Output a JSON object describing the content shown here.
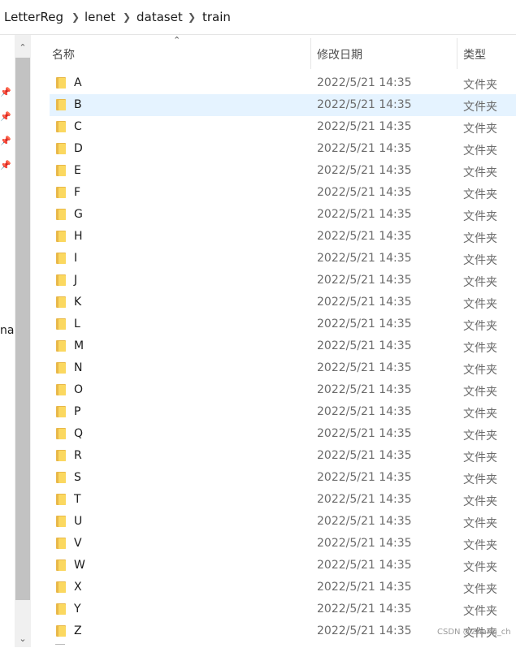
{
  "breadcrumb": {
    "items": [
      "LetterReg",
      "lenet",
      "dataset",
      "train"
    ]
  },
  "nav": {
    "truncated_label": "na"
  },
  "columns": {
    "name": "名称",
    "date": "修改日期",
    "type": "类型"
  },
  "files": [
    {
      "name": "A",
      "date": "2022/5/21 14:35",
      "type": "文件夹"
    },
    {
      "name": "B",
      "date": "2022/5/21 14:35",
      "type": "文件夹",
      "selected": true
    },
    {
      "name": "C",
      "date": "2022/5/21 14:35",
      "type": "文件夹"
    },
    {
      "name": "D",
      "date": "2022/5/21 14:35",
      "type": "文件夹"
    },
    {
      "name": "E",
      "date": "2022/5/21 14:35",
      "type": "文件夹"
    },
    {
      "name": "F",
      "date": "2022/5/21 14:35",
      "type": "文件夹"
    },
    {
      "name": "G",
      "date": "2022/5/21 14:35",
      "type": "文件夹"
    },
    {
      "name": "H",
      "date": "2022/5/21 14:35",
      "type": "文件夹"
    },
    {
      "name": "I",
      "date": "2022/5/21 14:35",
      "type": "文件夹"
    },
    {
      "name": "J",
      "date": "2022/5/21 14:35",
      "type": "文件夹"
    },
    {
      "name": "K",
      "date": "2022/5/21 14:35",
      "type": "文件夹"
    },
    {
      "name": "L",
      "date": "2022/5/21 14:35",
      "type": "文件夹"
    },
    {
      "name": "M",
      "date": "2022/5/21 14:35",
      "type": "文件夹"
    },
    {
      "name": "N",
      "date": "2022/5/21 14:35",
      "type": "文件夹"
    },
    {
      "name": "O",
      "date": "2022/5/21 14:35",
      "type": "文件夹"
    },
    {
      "name": "P",
      "date": "2022/5/21 14:35",
      "type": "文件夹"
    },
    {
      "name": "Q",
      "date": "2022/5/21 14:35",
      "type": "文件夹"
    },
    {
      "name": "R",
      "date": "2022/5/21 14:35",
      "type": "文件夹"
    },
    {
      "name": "S",
      "date": "2022/5/21 14:35",
      "type": "文件夹"
    },
    {
      "name": "T",
      "date": "2022/5/21 14:35",
      "type": "文件夹"
    },
    {
      "name": "U",
      "date": "2022/5/21 14:35",
      "type": "文件夹"
    },
    {
      "name": "V",
      "date": "2022/5/21 14:35",
      "type": "文件夹"
    },
    {
      "name": "W",
      "date": "2022/5/21 14:35",
      "type": "文件夹"
    },
    {
      "name": "X",
      "date": "2022/5/21 14:35",
      "type": "文件夹"
    },
    {
      "name": "Y",
      "date": "2022/5/21 14:35",
      "type": "文件夹"
    },
    {
      "name": "Z",
      "date": "2022/5/21 14:35",
      "type": "文件夹"
    }
  ],
  "watermark": "CSDN @Zhang_ch",
  "colors": {
    "selected_row": "#e5f3ff",
    "folder_front": "#fbd860",
    "folder_back": "#e8b84a"
  }
}
